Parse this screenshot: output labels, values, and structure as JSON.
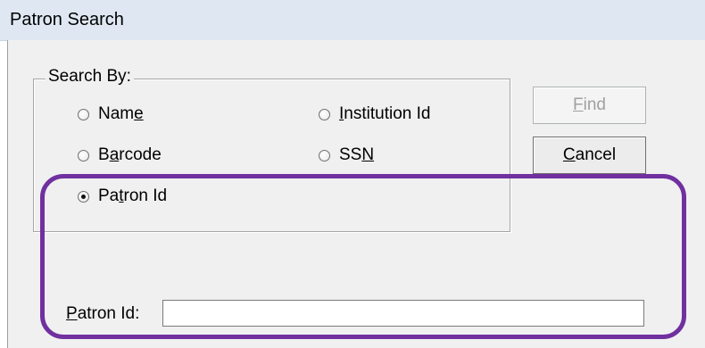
{
  "window": {
    "title": "Patron Search"
  },
  "search_by": {
    "legend": "Search By:",
    "options": [
      {
        "pre": "Nam",
        "key": "e",
        "post": "",
        "selected": false
      },
      {
        "pre": "",
        "key": "I",
        "post": "nstitution Id",
        "selected": false
      },
      {
        "pre": "B",
        "key": "a",
        "post": "rcode",
        "selected": false
      },
      {
        "pre": "SS",
        "key": "N",
        "post": "",
        "selected": false
      },
      {
        "pre": "Pa",
        "key": "t",
        "post": "ron Id",
        "selected": true
      }
    ]
  },
  "buttons": {
    "find": {
      "key": "F",
      "rest": "ind",
      "enabled": false
    },
    "cancel": {
      "key": "C",
      "rest": "ancel",
      "enabled": true
    }
  },
  "patron_id_field": {
    "key": "P",
    "rest": "atron Id:",
    "value": ""
  },
  "colors": {
    "highlight": "#7030a0",
    "titlebar": "#dfe8f2",
    "dialog_bg": "#f0f0f0"
  }
}
